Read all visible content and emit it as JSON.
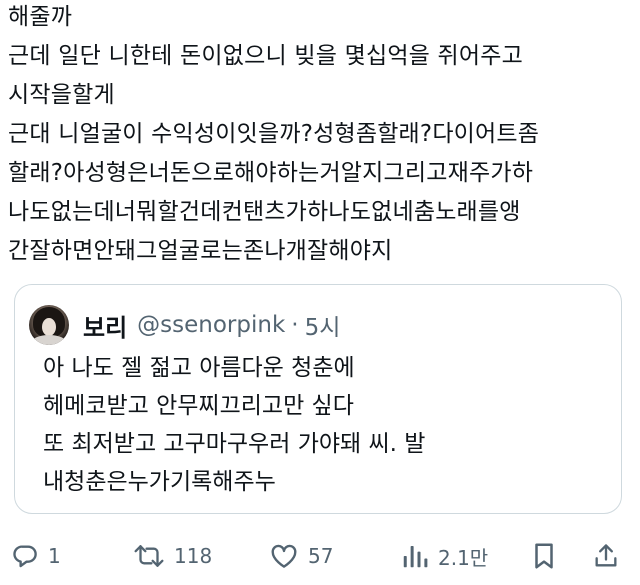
{
  "tweet": {
    "lines": [
      "해줄까",
      "근데 일단 니한테 돈이없으니 빚을 몇십억을 쥐어주고",
      "시작을할게",
      "근대 니얼굴이 수익성이잇을까?성형좀할래?다이어트좀",
      "할래?아성형은너돈으로해야하는거알지그리고재주가하",
      "나도없는데너뭐할건데컨탠츠가하나도없네춤노래를앵",
      "간잘하면안돼그얼굴로는존나개잘해야지"
    ]
  },
  "quote": {
    "name": "보리",
    "handle": "@ssenorpink",
    "separator": "·",
    "time": "5시",
    "lines": [
      "아 나도 젤 젊고 아름다운 청춘에",
      "헤메코받고 안무찌끄리고만 싶다",
      "또 최저받고 고구마구우러 가야돼 씨. 발",
      "내청춘은누가기록해주누"
    ]
  },
  "actions": {
    "reply": {
      "icon": "reply-icon",
      "count": "1"
    },
    "retweet": {
      "icon": "retweet-icon",
      "count": "118"
    },
    "like": {
      "icon": "heart-icon",
      "count": "57"
    },
    "views": {
      "icon": "views-icon",
      "count": "2.1만"
    },
    "bookmark": {
      "icon": "bookmark-icon"
    },
    "share": {
      "icon": "share-icon"
    }
  },
  "colors": {
    "text": "#0f1419",
    "secondary": "#536471",
    "border": "#cfd9de",
    "background": "#ffffff"
  }
}
